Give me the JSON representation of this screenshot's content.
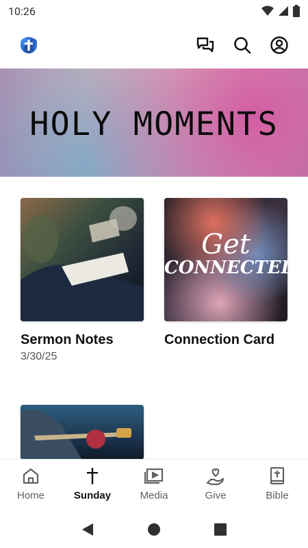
{
  "status_bar": {
    "time": "10:26"
  },
  "header": {
    "logo": "church-logo-icon",
    "actions": [
      "chat-icon",
      "search-icon",
      "account-icon"
    ]
  },
  "banner": {
    "title": "HOLY MOMENTS"
  },
  "cards": [
    {
      "title": "Sermon Notes",
      "subtitle": "3/30/25",
      "image": "people-with-notebooks"
    },
    {
      "title": "Connection Card",
      "subtitle": "",
      "image_text_line1": "Get",
      "image_text_line2": "CONNECTED"
    },
    {
      "title": "",
      "subtitle": "",
      "image": "guitar-player"
    }
  ],
  "bottom_nav": {
    "items": [
      {
        "label": "Home",
        "icon": "home-icon",
        "active": false
      },
      {
        "label": "Sunday",
        "icon": "cross-icon",
        "active": true
      },
      {
        "label": "Media",
        "icon": "media-icon",
        "active": false
      },
      {
        "label": "Give",
        "icon": "give-icon",
        "active": false
      },
      {
        "label": "Bible",
        "icon": "bible-icon",
        "active": false
      }
    ]
  },
  "colors": {
    "active_text": "#111111",
    "inactive_text": "#616161",
    "logo_blue": "#2f6fd6"
  }
}
